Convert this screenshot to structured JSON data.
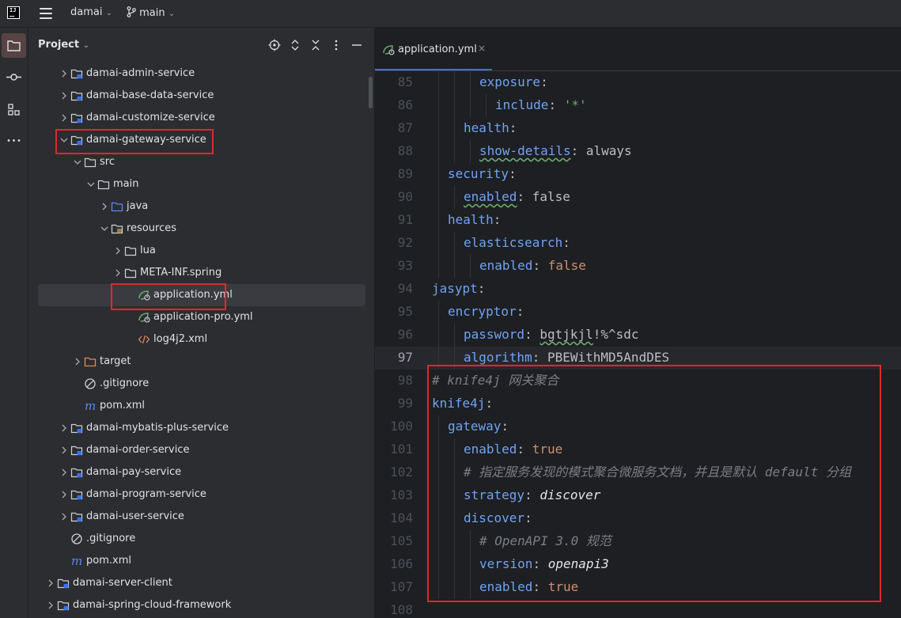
{
  "titlebar": {
    "project": "damai",
    "branch": "main"
  },
  "toolstrip": {
    "icons": [
      "folder-icon",
      "commit-icon",
      "structure-icon",
      "more-icon"
    ]
  },
  "project_panel": {
    "title": "Project",
    "tree": [
      {
        "label": "damai-admin-service",
        "icon": "module-folder-icon",
        "expanded": false
      },
      {
        "label": "damai-base-data-service",
        "icon": "module-folder-icon",
        "expanded": false
      },
      {
        "label": "damai-customize-service",
        "icon": "module-folder-icon",
        "expanded": false
      },
      {
        "label": "damai-gateway-service",
        "icon": "module-folder-icon",
        "expanded": true,
        "highlighted": true
      },
      {
        "label": "src",
        "icon": "folder-icon",
        "expanded": true
      },
      {
        "label": "main",
        "icon": "folder-icon",
        "expanded": true
      },
      {
        "label": "java",
        "icon": "source-folder-icon",
        "expanded": false
      },
      {
        "label": "resources",
        "icon": "resources-folder-icon",
        "expanded": true
      },
      {
        "label": "lua",
        "icon": "folder-icon",
        "expanded": false
      },
      {
        "label": "META-INF.spring",
        "icon": "folder-icon",
        "expanded": false
      },
      {
        "label": "application.yml",
        "icon": "spring-yml-icon",
        "selected": true,
        "highlighted": true
      },
      {
        "label": "application-pro.yml",
        "icon": "spring-yml-icon"
      },
      {
        "label": "log4j2.xml",
        "icon": "xml-file-icon"
      },
      {
        "label": "target",
        "icon": "excluded-folder-icon",
        "expanded": false
      },
      {
        "label": ".gitignore",
        "icon": "ignore-file-icon"
      },
      {
        "label": "pom.xml",
        "icon": "maven-file-icon"
      },
      {
        "label": "damai-mybatis-plus-service",
        "icon": "module-folder-icon",
        "expanded": false
      },
      {
        "label": "damai-order-service",
        "icon": "module-folder-icon",
        "expanded": false
      },
      {
        "label": "damai-pay-service",
        "icon": "module-folder-icon",
        "expanded": false
      },
      {
        "label": "damai-program-service",
        "icon": "module-folder-icon",
        "expanded": false
      },
      {
        "label": "damai-user-service",
        "icon": "module-folder-icon",
        "expanded": false
      },
      {
        "label": ".gitignore",
        "icon": "ignore-file-icon"
      },
      {
        "label": "pom.xml",
        "icon": "maven-file-icon"
      },
      {
        "label": "damai-server-client",
        "icon": "module-folder-icon",
        "expanded": false
      },
      {
        "label": "damai-spring-cloud-framework",
        "icon": "module-folder-icon",
        "expanded": false
      }
    ]
  },
  "editor": {
    "tab": {
      "label": "application.yml",
      "close": "×"
    },
    "current_line": 97,
    "lines": [
      {
        "n": "85",
        "tokens": [
          {
            "t": "exposure",
            "c": "k"
          },
          {
            "t": ":",
            "c": "plain"
          }
        ]
      },
      {
        "n": "86",
        "tokens": [
          {
            "t": "include",
            "c": "k"
          },
          {
            "t": ": ",
            "c": "plain"
          },
          {
            "t": "'*'",
            "c": "s"
          }
        ]
      },
      {
        "n": "87",
        "tokens": [
          {
            "t": "health",
            "c": "k"
          },
          {
            "t": ":",
            "c": "plain"
          }
        ]
      },
      {
        "n": "88",
        "tokens": [
          {
            "t": "show-details",
            "c": "k sq"
          },
          {
            "t": ": always",
            "c": "plain"
          }
        ]
      },
      {
        "n": "89",
        "tokens": [
          {
            "t": "security",
            "c": "k"
          },
          {
            "t": ":",
            "c": "plain"
          }
        ]
      },
      {
        "n": "90",
        "tokens": [
          {
            "t": "enabled",
            "c": "k sq"
          },
          {
            "t": ": false",
            "c": "plain"
          }
        ]
      },
      {
        "n": "91",
        "tokens": [
          {
            "t": "health",
            "c": "k"
          },
          {
            "t": ":",
            "c": "plain"
          }
        ]
      },
      {
        "n": "92",
        "tokens": [
          {
            "t": "elasticsearch",
            "c": "k"
          },
          {
            "t": ":",
            "c": "plain"
          }
        ]
      },
      {
        "n": "93",
        "tokens": [
          {
            "t": "enabled",
            "c": "k"
          },
          {
            "t": ": ",
            "c": "plain"
          },
          {
            "t": "false",
            "c": "kw"
          }
        ]
      },
      {
        "n": "94",
        "tokens": [
          {
            "t": "jasypt",
            "c": "k"
          },
          {
            "t": ":",
            "c": "plain"
          }
        ]
      },
      {
        "n": "95",
        "tokens": [
          {
            "t": "encryptor",
            "c": "k"
          },
          {
            "t": ":",
            "c": "plain"
          }
        ]
      },
      {
        "n": "96",
        "tokens": [
          {
            "t": "password",
            "c": "k"
          },
          {
            "t": ": ",
            "c": "plain"
          },
          {
            "t": "bgtjkjl",
            "c": "plain sq"
          },
          {
            "t": "!%^sdc",
            "c": "plain"
          }
        ]
      },
      {
        "n": "97",
        "tokens": [
          {
            "t": "algorithm",
            "c": "k"
          },
          {
            "t": ": PBEWithMD5AndDES",
            "c": "plain"
          }
        ]
      },
      {
        "n": "98",
        "tokens": [
          {
            "t": "# knife4j 网关聚合",
            "c": "c"
          }
        ]
      },
      {
        "n": "99",
        "tokens": [
          {
            "t": "knife4j",
            "c": "k"
          },
          {
            "t": ":",
            "c": "plain"
          }
        ]
      },
      {
        "n": "100",
        "tokens": [
          {
            "t": "gateway",
            "c": "k"
          },
          {
            "t": ":",
            "c": "plain"
          }
        ]
      },
      {
        "n": "101",
        "tokens": [
          {
            "t": "enabled",
            "c": "k"
          },
          {
            "t": ": ",
            "c": "plain"
          },
          {
            "t": "true",
            "c": "kw"
          }
        ]
      },
      {
        "n": "102",
        "tokens": [
          {
            "t": "# 指定服务发现的模式聚合微服务文档，并且是默认 default 分组",
            "c": "c"
          }
        ]
      },
      {
        "n": "103",
        "tokens": [
          {
            "t": "strategy",
            "c": "k"
          },
          {
            "t": ": ",
            "c": "plain"
          },
          {
            "t": "discover",
            "c": "bi"
          }
        ]
      },
      {
        "n": "104",
        "tokens": [
          {
            "t": "discover",
            "c": "k"
          },
          {
            "t": ":",
            "c": "plain"
          }
        ]
      },
      {
        "n": "105",
        "tokens": [
          {
            "t": "# OpenAPI 3.0 规范",
            "c": "c"
          }
        ]
      },
      {
        "n": "106",
        "tokens": [
          {
            "t": "version",
            "c": "k"
          },
          {
            "t": ": ",
            "c": "plain"
          },
          {
            "t": "openapi3",
            "c": "bi"
          }
        ]
      },
      {
        "n": "107",
        "tokens": [
          {
            "t": "enabled",
            "c": "k"
          },
          {
            "t": ": ",
            "c": "plain"
          },
          {
            "t": "true",
            "c": "kw"
          }
        ]
      },
      {
        "n": "108",
        "tokens": []
      }
    ]
  },
  "colors": {
    "highlight_box": "#e3262e",
    "key": "#6fa3f5",
    "comment": "#7a7e85",
    "keyword": "#cf8e6d",
    "string": "#6aab73"
  }
}
